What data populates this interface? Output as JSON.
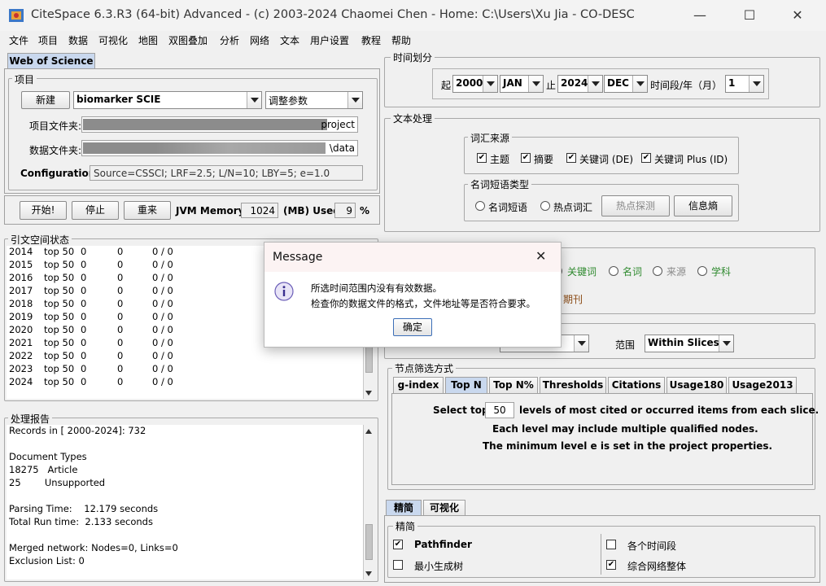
{
  "window": {
    "title": "CiteSpace 6.3.R3 (64-bit) Advanced - (c) 2003-2024 Chaomei Chen - Home: C:\\Users\\Xu Jia - CO-DESC",
    "minimize": "—",
    "maximize": "☐",
    "close": "✕"
  },
  "menu": [
    "文件",
    "项目",
    "数据",
    "可视化",
    "地图",
    "双图叠加",
    "分析",
    "网络",
    "文本",
    "用户设置",
    "教程",
    "帮助"
  ],
  "left_tab": "Web of Science",
  "project": {
    "legend": "项目",
    "new_button": "新建",
    "project_combo": "biomarker SCIE",
    "params_combo": "调整参数",
    "project_folder_label": "项目文件夹:",
    "project_folder_value": "project",
    "data_folder_label": "数据文件夹:",
    "data_folder_value": "\\data",
    "config_label": "Configuration:",
    "config_value": "Source=CSSCI; LRF=2.5; L/N=10; LBY=5; e=1.0"
  },
  "controls": {
    "start": "开始!",
    "stop": "停止",
    "reset": "重来",
    "jvm_label": "JVM Memory",
    "jvm_value": "1024",
    "mb_used": "(MB) Used",
    "used_value": "9",
    "percent": "%"
  },
  "citation_status": {
    "legend": "引文空间状态",
    "rows": [
      {
        "year": "2014",
        "top": "top 50",
        "a": "0",
        "b": "0",
        "c": "0 / 0"
      },
      {
        "year": "2015",
        "top": "top 50",
        "a": "0",
        "b": "0",
        "c": "0 / 0"
      },
      {
        "year": "2016",
        "top": "top 50",
        "a": "0",
        "b": "0",
        "c": "0 / 0"
      },
      {
        "year": "2017",
        "top": "top 50",
        "a": "0",
        "b": "0",
        "c": "0 / 0"
      },
      {
        "year": "2018",
        "top": "top 50",
        "a": "0",
        "b": "0",
        "c": "0 / 0"
      },
      {
        "year": "2019",
        "top": "top 50",
        "a": "0",
        "b": "0",
        "c": "0 / 0"
      },
      {
        "year": "2020",
        "top": "top 50",
        "a": "0",
        "b": "0",
        "c": "0 / 0"
      },
      {
        "year": "2021",
        "top": "top 50",
        "a": "0",
        "b": "0",
        "c": "0 / 0"
      },
      {
        "year": "2022",
        "top": "top 50",
        "a": "0",
        "b": "0",
        "c": "0 / 0"
      },
      {
        "year": "2023",
        "top": "top 50",
        "a": "0",
        "b": "0",
        "c": "0 / 0"
      },
      {
        "year": "2024",
        "top": "top 50",
        "a": "0",
        "b": "0",
        "c": "0 / 0"
      }
    ]
  },
  "report": {
    "legend": "处理报告",
    "lines": [
      "Records in [ 2000-2024]: 732",
      "",
      "Document Types",
      "18275   Article",
      "25        Unsupported",
      "",
      "Parsing Time:    12.179 seconds",
      "Total Run time:  2.133 seconds",
      "",
      "Merged network: Nodes=0, Links=0",
      "Exclusion List: 0"
    ]
  },
  "time_slicing": {
    "legend": "时间划分",
    "from_label": "起",
    "from_year": "2000",
    "from_month": "JAN",
    "to_label": "止",
    "to_year": "2024",
    "to_month": "DEC",
    "slice_label": "时间段/年（月）",
    "slice_value": "1"
  },
  "text_processing": {
    "legend": "文本处理",
    "source_legend": "词汇来源",
    "sources": [
      "主题",
      "摘要",
      "关键词 (DE)",
      "关键词 Plus (ID)"
    ],
    "phrase_legend": "名词短语类型",
    "phrase_types": [
      "名词短语",
      "热点词汇"
    ],
    "burst_button": "热点探测",
    "entropy_button": "信息熵"
  },
  "node_types": {
    "keyword": "关键词",
    "noun": "名词",
    "source": "来源",
    "category": "学科",
    "journal": "期刊"
  },
  "links": {
    "scope_label": "范围",
    "scope_value": "Within Slices"
  },
  "node_selection": {
    "legend": "节点筛选方式",
    "tabs": [
      "g-index",
      "Top N",
      "Top N%",
      "Thresholds",
      "Citations",
      "Usage180",
      "Usage2013"
    ],
    "select_top": "Select top",
    "top_value": "50",
    "top_desc": "levels of most cited or occurred items from each slice.",
    "line2": "Each level may include multiple qualified nodes.",
    "line3": "The minimum level e is set in the project properties."
  },
  "pruning": {
    "tabs": [
      "精简",
      "可视化"
    ],
    "legend": "精简",
    "pathfinder": "Pathfinder",
    "mst": "最小生成树",
    "each_slice": "各个时间段",
    "merged": "综合网络整体"
  },
  "dialog": {
    "title": "Message",
    "close": "✕",
    "line1": "所选时间范围内没有有效数据。",
    "line2": "检查你的数据文件的格式，文件地址等是否符合要求。",
    "ok": "确定"
  },
  "colors": {
    "tab_selected": "#c9d8ee",
    "keyword_green": "#2f8a2f",
    "journal_brown": "#8a4a14"
  }
}
